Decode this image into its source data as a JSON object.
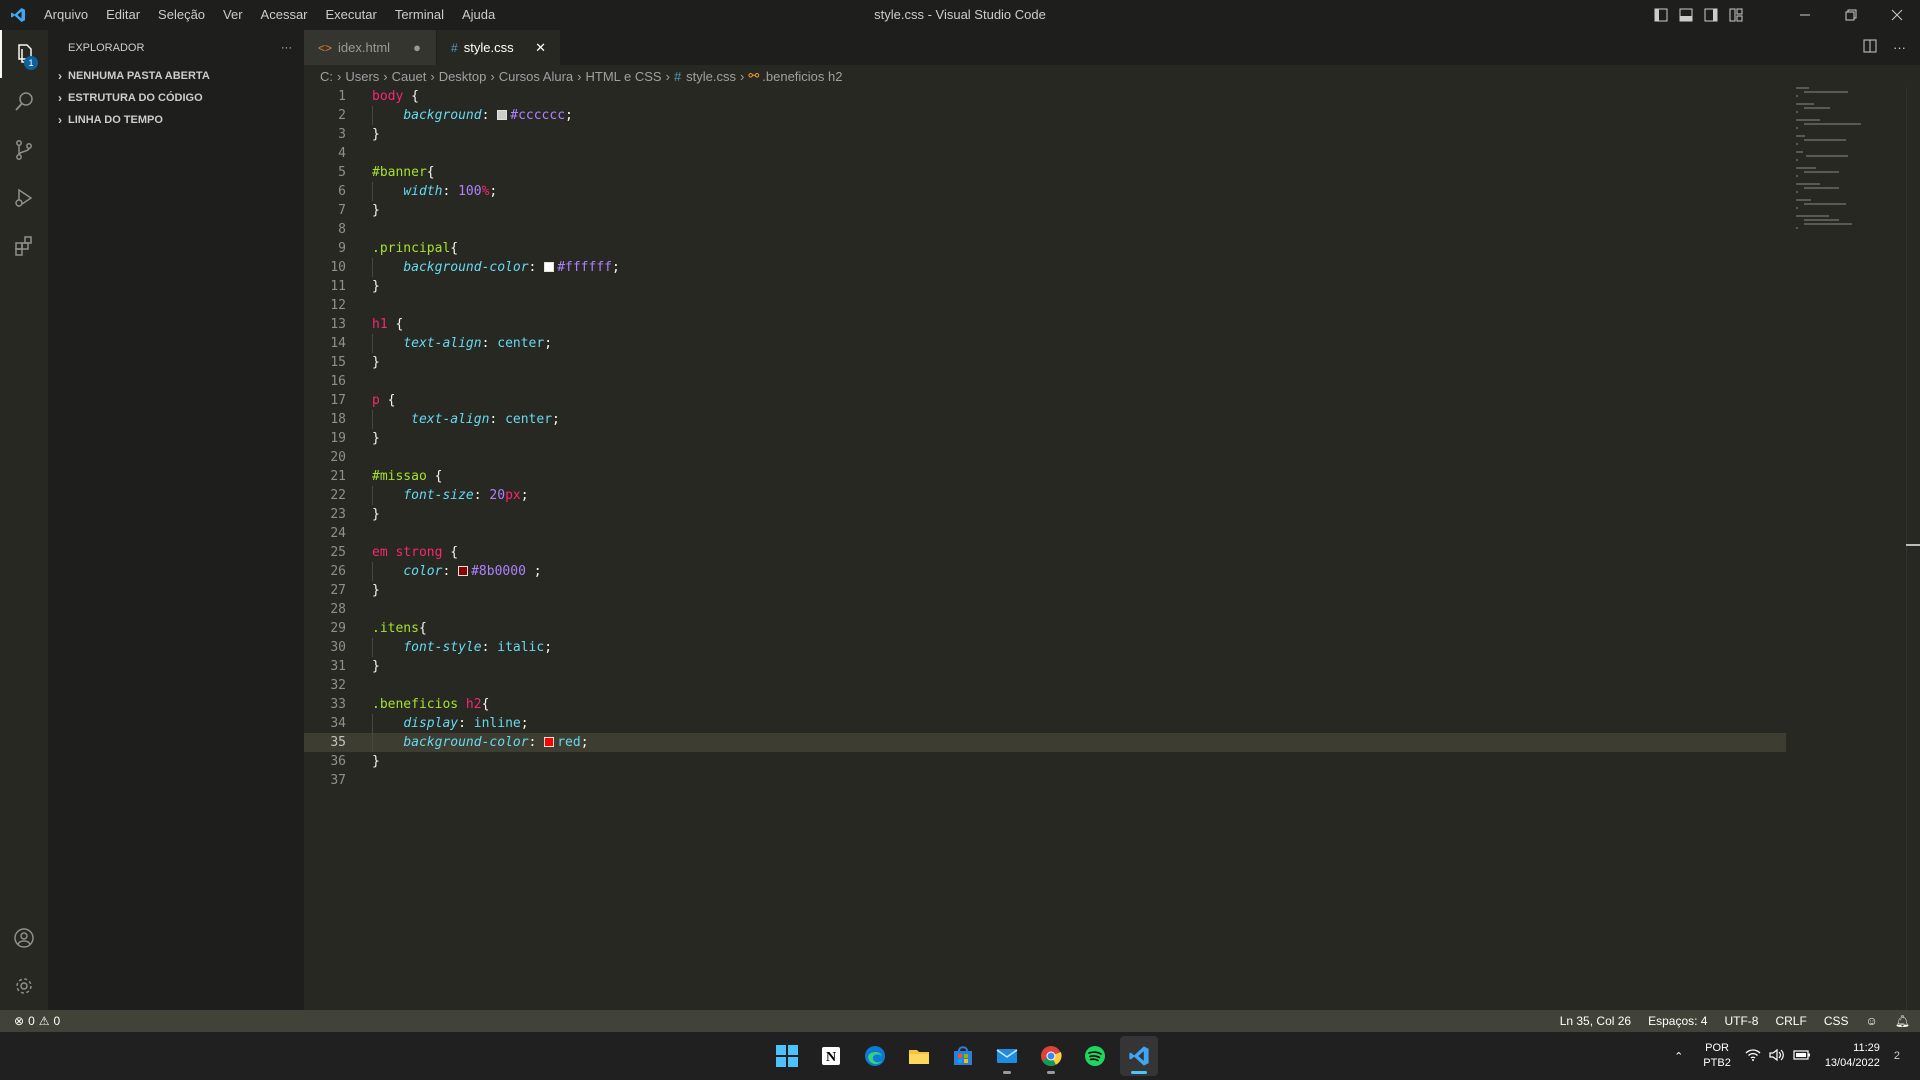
{
  "window": {
    "title": "style.css - Visual Studio Code",
    "menu": [
      "Arquivo",
      "Editar",
      "Seleção",
      "Ver",
      "Acessar",
      "Executar",
      "Terminal",
      "Ajuda"
    ]
  },
  "activitybar": {
    "explorer_badge": "1"
  },
  "sidebar": {
    "title": "EXPLORADOR",
    "more": "···",
    "sections": [
      "NENHUMA PASTA ABERTA",
      "ESTRUTURA DO CÓDIGO",
      "LINHA DO TEMPO"
    ]
  },
  "tabs": [
    {
      "label": "idex.html",
      "icon": "<>",
      "status": "●"
    },
    {
      "label": "style.css",
      "icon": "#",
      "status": "✕"
    }
  ],
  "breadcrumb": {
    "parts": [
      "C:",
      "Users",
      "Cauet",
      "Desktop",
      "Cursos Alura",
      "HTML e CSS"
    ],
    "file": "style.css",
    "symbol": ".beneficios h2"
  },
  "editor": {
    "current_line": 35,
    "lines": [
      "body {",
      "    background: #cccccc;",
      "}",
      "",
      "#banner{",
      "    width: 100%;",
      "}",
      "",
      ".principal{",
      "    background-color: #ffffff;",
      "}",
      "",
      "h1 {",
      "    text-align: center;",
      "}",
      "",
      "p {",
      "     text-align: center;",
      "}",
      "",
      "#missao {",
      "    font-size: 20px;",
      "}",
      "",
      "em strong {",
      "    color: #8b0000 ;",
      "}",
      "",
      ".itens{",
      "    font-style: italic;",
      "}",
      "",
      ".beneficios h2{",
      "    display: inline;",
      "    background-color: red;",
      "}",
      ""
    ],
    "swatch_colors": {
      "cccccc": "#cccccc",
      "ffffff": "#ffffff",
      "8b0000": "#8b0000",
      "red": "#ff0000"
    }
  },
  "statusbar": {
    "errors": "0",
    "warnings": "0",
    "position": "Ln 35, Col 26",
    "spaces": "Espaços: 4",
    "encoding": "UTF-8",
    "eol": "CRLF",
    "language": "CSS"
  },
  "taskbar": {
    "apps": [
      "windows-start-icon",
      "notion-icon",
      "edge-icon",
      "file-explorer-icon",
      "store-icon",
      "mail-icon",
      "chrome-icon",
      "spotify-icon",
      "vscode-icon"
    ],
    "lang_top": "POR",
    "lang_bottom": "PTB2",
    "time": "11:29",
    "date": "13/04/2022",
    "notification_count": "2"
  },
  "colors": {
    "editor_bg": "#272822",
    "sidebar_bg": "#1e1f1c",
    "statusbar_bg": "#414339",
    "keyword_pink": "#f92672",
    "selector_green": "#a6e22e",
    "property_blue": "#66d9ef",
    "number_purple": "#ae81ff"
  }
}
